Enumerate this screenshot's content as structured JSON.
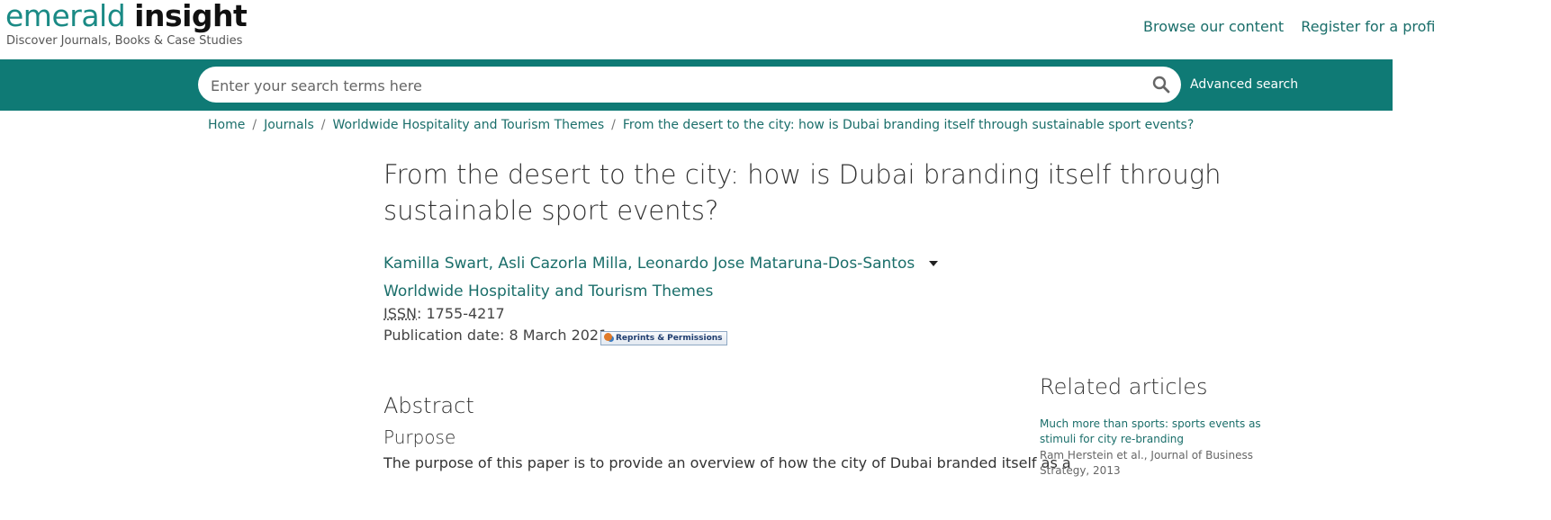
{
  "logo": {
    "word1": "emerald",
    "word2": "insight",
    "tagline": "Discover Journals, Books & Case Studies"
  },
  "top_nav": {
    "browse": "Browse our content",
    "register": "Register for a profi"
  },
  "search": {
    "placeholder": "Enter your search terms here",
    "advanced": "Advanced search"
  },
  "breadcrumb": {
    "items": [
      "Home",
      "Journals",
      "Worldwide Hospitality and Tourism Themes",
      "From the desert to the city: how is Dubai branding itself through sustainable sport events?"
    ],
    "separator": "/"
  },
  "article": {
    "title": "From the desert to the city: how is Dubai branding itself through sustainable sport events?",
    "authors": "Kamilla Swart, Asli Cazorla Milla, Leonardo Jose Mataruna-Dos-Santos",
    "journal": "Worldwide Hospitality and Tourism Themes",
    "issn_label": "ISSN",
    "issn_value": ": 1755-4217",
    "publication_date": "Publication date: 8 March 2021",
    "reprints_label": "Reprints & Permissions"
  },
  "abstract": {
    "heading": "Abstract",
    "purpose_heading": "Purpose",
    "purpose_text": "The purpose of this paper is to provide an overview of how the city of Dubai branded itself as a"
  },
  "related": {
    "heading": "Related articles",
    "items": [
      {
        "title": "Much more than sports: sports events as stimuli for city re-branding",
        "meta": "Ram Herstein et al., Journal of Business Strategy, 2013"
      }
    ]
  },
  "colors": {
    "brand_teal": "#0f7a75",
    "link_teal": "#1a6e6a"
  }
}
